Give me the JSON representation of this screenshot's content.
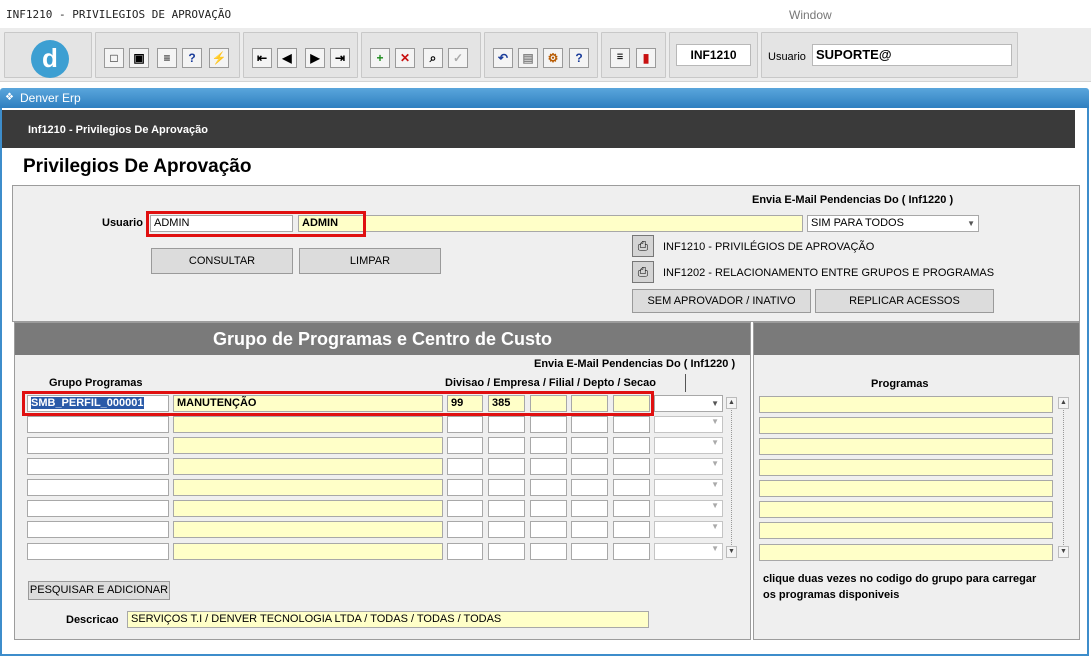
{
  "titlebar": {
    "title": "INF1210 - PRIVILEGIOS DE APROVAÇÃO",
    "menu": "Window"
  },
  "toolbar": {
    "logo": "d",
    "program_code": "INF1210",
    "user_label": "Usuario",
    "user_value": "SUPORTE@"
  },
  "window": {
    "title": "Denver Erp"
  },
  "header": {
    "breadcrumb": "Inf1210 - Privilegios De Aprovação",
    "page_title": "Privilegios De Aprovação"
  },
  "form": {
    "email_label": "Envia E-Mail Pendencias Do ( Inf1220 )",
    "usuario_label": "Usuario",
    "usuario_code": "ADMIN",
    "usuario_name": "ADMIN",
    "email_select": "SIM PARA TODOS",
    "consultar": "CONSULTAR",
    "limpar": "LIMPAR",
    "report1": "INF1210 - PRIVILÉGIOS DE APROVAÇÃO",
    "report2": "INF1202 - RELACIONAMENTO ENTRE GRUPOS E PROGRAMAS",
    "sem_aprovador": "SEM APROVADOR / INATIVO",
    "replicar": "REPLICAR ACESSOS"
  },
  "groups": {
    "title": "Grupo de Programas e Centro de Custo",
    "email_label": "Envia E-Mail Pendencias Do ( Inf1220 )",
    "col_grupo": "Grupo Programas",
    "col_divisao": "Divisao / Empresa / Filial / Depto / Secao",
    "rows": [
      {
        "code": "SMB_PERFIL_000001",
        "name": "MANUTENÇÃO",
        "div": "99",
        "emp": "385",
        "fil": "",
        "dep": "",
        "sec": ""
      }
    ],
    "pesquisar": "PESQUISAR E ADICIONAR",
    "descricao_label": "Descricao",
    "descricao": "SERVIÇOS T.I / DENVER TECNOLOGIA LTDA / TODAS / TODAS / TODAS"
  },
  "programs": {
    "title": "Programas",
    "hint_line1": "clique duas vezes no codigo do grupo para carregar",
    "hint_line2": "os programas disponiveis"
  }
}
